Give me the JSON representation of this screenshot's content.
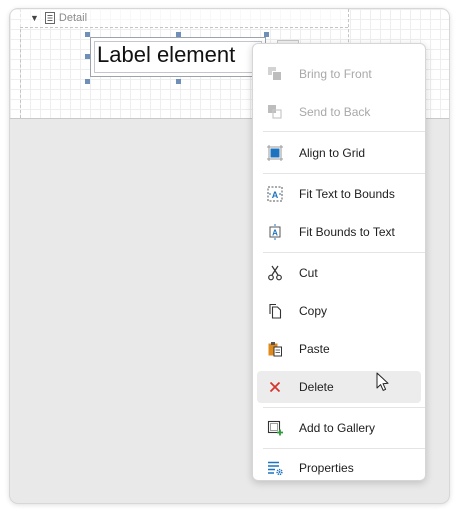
{
  "band": {
    "name": "Detail"
  },
  "label_element": {
    "text": "Label element"
  },
  "context_menu": {
    "items": [
      {
        "label": "Bring to Front",
        "icon": "bring-to-front-icon",
        "enabled": false
      },
      {
        "label": "Send to Back",
        "icon": "send-to-back-icon",
        "enabled": false
      },
      {
        "label": "Align to Grid",
        "icon": "align-to-grid-icon",
        "enabled": true
      },
      {
        "label": "Fit Text to Bounds",
        "icon": "fit-text-to-bounds-icon",
        "enabled": true
      },
      {
        "label": "Fit Bounds to Text",
        "icon": "fit-bounds-to-text-icon",
        "enabled": true
      },
      {
        "label": "Cut",
        "icon": "scissors-icon",
        "enabled": true
      },
      {
        "label": "Copy",
        "icon": "copy-icon",
        "enabled": true
      },
      {
        "label": "Paste",
        "icon": "paste-icon",
        "enabled": true
      },
      {
        "label": "Delete",
        "icon": "close-x-icon",
        "enabled": true,
        "hovered": true
      },
      {
        "label": "Add to Gallery",
        "icon": "add-to-gallery-icon",
        "enabled": true
      },
      {
        "label": "Properties",
        "icon": "properties-icon",
        "enabled": true
      }
    ]
  },
  "colors": {
    "accent_blue": "#1e73be",
    "delete_red": "#d9332b",
    "paste_orange": "#e08a1e",
    "disabled_text": "#a8a8a8",
    "hover_bg": "#ececec"
  }
}
